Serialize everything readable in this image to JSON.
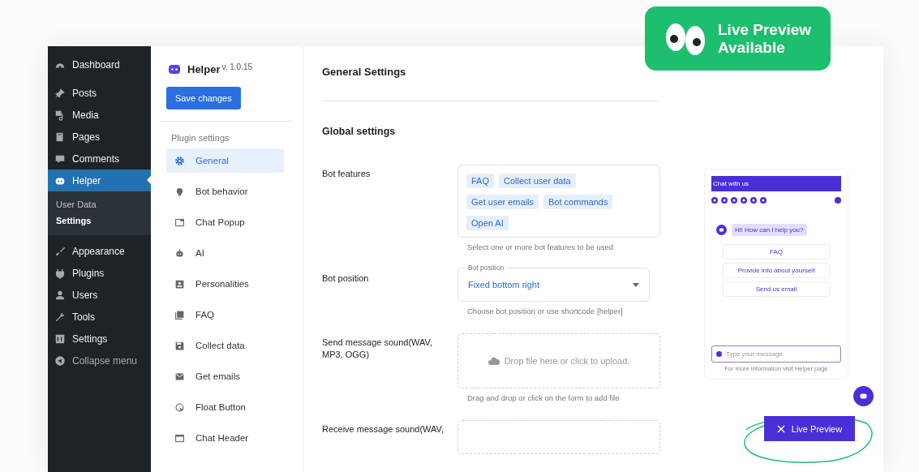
{
  "wp_menu": [
    {
      "label": "Dashboard",
      "selected": false
    },
    {
      "label": "Posts",
      "selected": false
    },
    {
      "label": "Media",
      "selected": false
    },
    {
      "label": "Pages",
      "selected": false
    },
    {
      "label": "Comments",
      "selected": false
    },
    {
      "label": "Helper",
      "selected": true,
      "children": [
        {
          "label": "User Data",
          "selected": false
        },
        {
          "label": "Settings",
          "selected": true
        }
      ]
    },
    {
      "label": "Appearance",
      "selected": false
    },
    {
      "label": "Plugins",
      "selected": false
    },
    {
      "label": "Users",
      "selected": false
    },
    {
      "label": "Tools",
      "selected": false
    },
    {
      "label": "Settings",
      "selected": false
    }
  ],
  "collapse_label": "Collapse menu",
  "plugin": {
    "name": "Helper",
    "version": "v. 1.0.15",
    "save_button": "Save changes",
    "section_label": "Plugin settings",
    "nav": [
      {
        "label": "General",
        "selected": true
      },
      {
        "label": "Bot behavior",
        "selected": false
      },
      {
        "label": "Chat Popup",
        "selected": false
      },
      {
        "label": "AI",
        "selected": false
      },
      {
        "label": "Personalities",
        "selected": false
      },
      {
        "label": "FAQ",
        "selected": false
      },
      {
        "label": "Collect data",
        "selected": false
      },
      {
        "label": "Get emails",
        "selected": false
      },
      {
        "label": "Float Button",
        "selected": false
      },
      {
        "label": "Chat Header",
        "selected": false
      }
    ]
  },
  "main": {
    "title": "General Settings",
    "subtitle": "Global settings",
    "fields": [
      {
        "kind": "chips",
        "label": "Bot features",
        "chips": [
          "FAQ",
          "Collect user data",
          "Get user emails",
          "Bot commands",
          "Open AI"
        ],
        "hint": "Select one or more bot features to be used"
      },
      {
        "kind": "select",
        "label": "Bot position",
        "field_label": "Bot position",
        "value": "Fixed bottom right",
        "hint": "Choose bot position or use shortcode [helper]"
      },
      {
        "kind": "upload",
        "label": "Send message sound(WAV, MP3, OGG)",
        "prompt": "Drop file here or click to upload.",
        "hint": "Drag and drop or click on the form to add file"
      },
      {
        "kind": "upload",
        "label": "Receive message sound(WAV,"
      }
    ]
  },
  "preview": {
    "chat_title": "Chat with us",
    "bot_message": "Hi! How can I help you?",
    "options": [
      "FAQ",
      "Provide info about yourself",
      "Send us email"
    ],
    "input_placeholder": "Type your message",
    "footer": "For more information visit Helper page",
    "button": "Live Preview"
  },
  "badge": {
    "text": "Live Preview Available"
  }
}
